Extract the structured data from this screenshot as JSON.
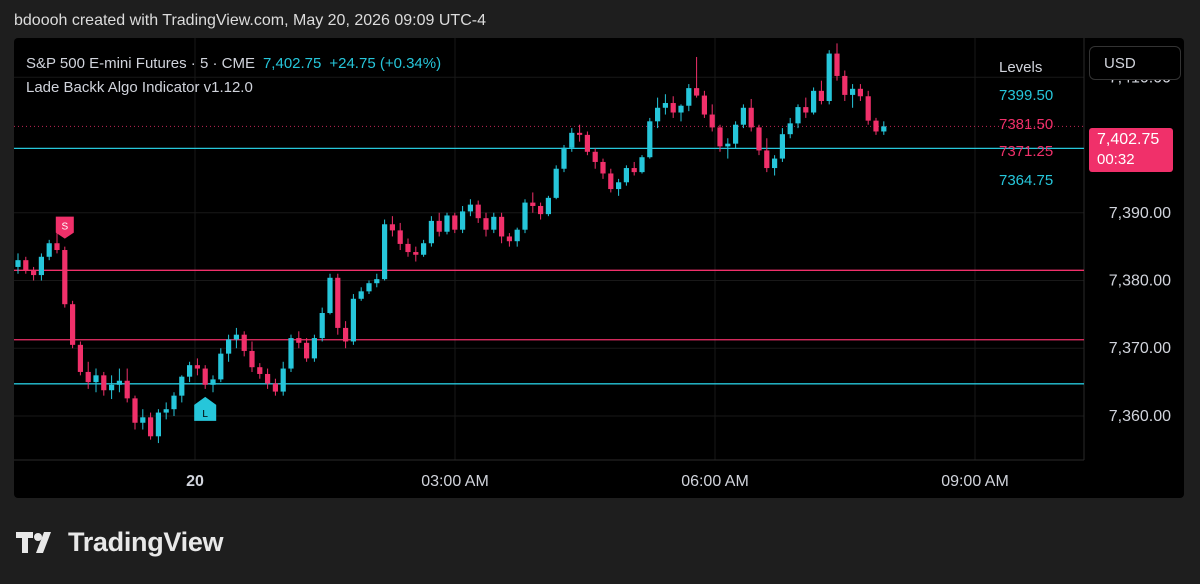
{
  "header": {
    "credit": "bdoooh created with TradingView.com, May 20, 2026 09:09 UTC-4"
  },
  "legend": {
    "symbol": "S&P 500 E-mini Futures · 5 · CME",
    "last": "7,402.75",
    "change": "+24.75 (+0.34%)",
    "indicator": "Lade Backk Algo Indicator v1.12.0"
  },
  "currency": "USD",
  "price_tag": {
    "value": "7,402.75",
    "countdown": "00:32"
  },
  "levels_title": "Levels",
  "brand": {
    "name": "TradingView"
  },
  "colors": {
    "up": "#26c6da",
    "down": "#f0306a",
    "background": "#000000"
  },
  "chart_data": {
    "type": "candlestick",
    "x_ticks": [
      "20",
      "03:00 AM",
      "06:00 AM",
      "09:00 AM"
    ],
    "y_ticks": [
      "7,410.00",
      "7,390.00",
      "7,380.00",
      "7,370.00",
      "7,360.00"
    ],
    "ylim": [
      7353.5,
      7415.8
    ],
    "levels": [
      {
        "label": "7399.50",
        "value": 7399.5,
        "color": "#26c6da"
      },
      {
        "label": "7381.50",
        "value": 7381.5,
        "color": "#f0306a"
      },
      {
        "label": "7371.25",
        "value": 7371.25,
        "color": "#f0306a"
      },
      {
        "label": "7364.75",
        "value": 7364.75,
        "color": "#26c6da"
      }
    ],
    "last_price": 7402.75,
    "signals": [
      {
        "label": "S",
        "type": "sell",
        "index": 6
      },
      {
        "label": "L",
        "type": "long",
        "index": 24
      }
    ],
    "ohlc": [
      [
        7382,
        7384,
        7381,
        7383
      ],
      [
        7383,
        7383.5,
        7381,
        7381.5
      ],
      [
        7381.5,
        7382,
        7380,
        7380.8
      ],
      [
        7380.8,
        7384,
        7380,
        7383.5
      ],
      [
        7383.5,
        7386,
        7383,
        7385.5
      ],
      [
        7385.5,
        7387.5,
        7384,
        7384.5
      ],
      [
        7384.5,
        7385,
        7376,
        7376.5
      ],
      [
        7376.5,
        7377,
        7370,
        7370.5
      ],
      [
        7370.5,
        7371,
        7366,
        7366.5
      ],
      [
        7366.5,
        7368,
        7364,
        7365
      ],
      [
        7365,
        7367,
        7363.5,
        7366
      ],
      [
        7366,
        7366.5,
        7363,
        7363.8
      ],
      [
        7363.8,
        7366,
        7362.5,
        7364.6
      ],
      [
        7364.6,
        7367,
        7363.5,
        7365.2
      ],
      [
        7365.2,
        7367,
        7362,
        7362.6
      ],
      [
        7362.6,
        7363,
        7358,
        7359
      ],
      [
        7359,
        7361,
        7358,
        7359.8
      ],
      [
        7359.8,
        7360.5,
        7356.5,
        7357
      ],
      [
        7357,
        7361,
        7356,
        7360.5
      ],
      [
        7360.5,
        7362,
        7359.5,
        7361
      ],
      [
        7361,
        7363.5,
        7360,
        7363
      ],
      [
        7363,
        7366,
        7362,
        7365.8
      ],
      [
        7365.8,
        7368,
        7365,
        7367.5
      ],
      [
        7367.5,
        7368.5,
        7366,
        7367
      ],
      [
        7367,
        7367.5,
        7364,
        7364.6
      ],
      [
        7364.6,
        7366,
        7363.5,
        7365.4
      ],
      [
        7365.4,
        7370,
        7365,
        7369.2
      ],
      [
        7369.2,
        7372,
        7368,
        7371.3
      ],
      [
        7371.3,
        7373,
        7370,
        7372
      ],
      [
        7372,
        7372.5,
        7368.8,
        7369.6
      ],
      [
        7369.6,
        7371,
        7366.5,
        7367.2
      ],
      [
        7367.2,
        7367.8,
        7365.5,
        7366.2
      ],
      [
        7366.2,
        7367,
        7364,
        7364.8
      ],
      [
        7364.8,
        7365.5,
        7363,
        7363.6
      ],
      [
        7363.6,
        7368,
        7363,
        7367
      ],
      [
        7367,
        7372,
        7366.5,
        7371.5
      ],
      [
        7371.5,
        7372.5,
        7370,
        7370.8
      ],
      [
        7370.8,
        7371.5,
        7368,
        7368.5
      ],
      [
        7368.5,
        7372,
        7368,
        7371.5
      ],
      [
        7371.5,
        7376,
        7371,
        7375.2
      ],
      [
        7375.2,
        7381,
        7375,
        7380.4
      ],
      [
        7380.4,
        7381,
        7372,
        7373
      ],
      [
        7373,
        7374,
        7370,
        7371
      ],
      [
        7371,
        7378,
        7370.5,
        7377.3
      ],
      [
        7377.3,
        7379,
        7377,
        7378.4
      ],
      [
        7378.4,
        7380,
        7378,
        7379.6
      ],
      [
        7379.6,
        7381,
        7379,
        7380.2
      ],
      [
        7380.2,
        7389,
        7380,
        7388.3
      ],
      [
        7388.3,
        7389.5,
        7386.5,
        7387.4
      ],
      [
        7387.4,
        7388.5,
        7384.5,
        7385.4
      ],
      [
        7385.4,
        7386.2,
        7383.5,
        7384.2
      ],
      [
        7384.2,
        7385,
        7382.8,
        7383.8
      ],
      [
        7383.8,
        7386,
        7383.5,
        7385.5
      ],
      [
        7385.5,
        7389.5,
        7385,
        7388.8
      ],
      [
        7388.8,
        7390,
        7386.5,
        7387.2
      ],
      [
        7387.2,
        7390,
        7386.8,
        7389.6
      ],
      [
        7389.6,
        7390,
        7387,
        7387.5
      ],
      [
        7387.5,
        7391,
        7387,
        7390.2
      ],
      [
        7390.2,
        7392,
        7389.5,
        7391.2
      ],
      [
        7391.2,
        7391.8,
        7388.5,
        7389.2
      ],
      [
        7389.2,
        7390,
        7386.5,
        7387.5
      ],
      [
        7387.5,
        7390,
        7387,
        7389.4
      ],
      [
        7389.4,
        7390,
        7385.5,
        7386.5
      ],
      [
        7386.5,
        7387,
        7385,
        7385.8
      ],
      [
        7385.8,
        7387.8,
        7385,
        7387.5
      ],
      [
        7387.5,
        7392,
        7387,
        7391.5
      ],
      [
        7391.5,
        7393,
        7390,
        7391
      ],
      [
        7391,
        7391.5,
        7389,
        7389.8
      ],
      [
        7389.8,
        7392.5,
        7389.5,
        7392.2
      ],
      [
        7392.2,
        7397,
        7392,
        7396.5
      ],
      [
        7396.5,
        7400,
        7396,
        7399.6
      ],
      [
        7399.6,
        7402.5,
        7399,
        7401.8
      ],
      [
        7401.8,
        7403,
        7400.5,
        7401.5
      ],
      [
        7401.5,
        7402,
        7398.5,
        7399
      ],
      [
        7399,
        7399.5,
        7396.5,
        7397.5
      ],
      [
        7397.5,
        7398,
        7395,
        7395.8
      ],
      [
        7395.8,
        7396.5,
        7393,
        7393.5
      ],
      [
        7393.5,
        7395,
        7392.5,
        7394.5
      ],
      [
        7394.5,
        7397,
        7394,
        7396.6
      ],
      [
        7396.6,
        7397.5,
        7395.5,
        7396
      ],
      [
        7396,
        7398.5,
        7395.8,
        7398.2
      ],
      [
        7398.2,
        7404,
        7398,
        7403.5
      ],
      [
        7403.5,
        7407,
        7402.5,
        7405.5
      ],
      [
        7405.5,
        7407.5,
        7404.5,
        7406.2
      ],
      [
        7406.2,
        7407.2,
        7404,
        7404.8
      ],
      [
        7404.8,
        7406,
        7403.5,
        7405.8
      ],
      [
        7405.8,
        7409,
        7405,
        7408.4
      ],
      [
        7408.4,
        7413,
        7407,
        7407.3
      ],
      [
        7407.3,
        7408,
        7404,
        7404.5
      ],
      [
        7404.5,
        7406,
        7402,
        7402.6
      ],
      [
        7402.6,
        7403,
        7399,
        7399.8
      ],
      [
        7399.8,
        7401,
        7398,
        7400.2
      ],
      [
        7400.2,
        7403.5,
        7399.5,
        7403
      ],
      [
        7403,
        7406,
        7402.5,
        7405.5
      ],
      [
        7405.5,
        7406.8,
        7402,
        7402.6
      ],
      [
        7402.6,
        7403,
        7398.5,
        7399.2
      ],
      [
        7399.2,
        7401,
        7396,
        7396.6
      ],
      [
        7396.6,
        7398.5,
        7395.5,
        7398
      ],
      [
        7398,
        7402.5,
        7397.5,
        7401.6
      ],
      [
        7401.6,
        7404,
        7401,
        7403.2
      ],
      [
        7403.2,
        7406,
        7402.5,
        7405.6
      ],
      [
        7405.6,
        7407,
        7404,
        7404.8
      ],
      [
        7404.8,
        7408.5,
        7404.5,
        7408
      ],
      [
        7408,
        7409.5,
        7406,
        7406.5
      ],
      [
        7406.5,
        7414,
        7406,
        7413.5
      ],
      [
        7413.5,
        7415,
        7409.5,
        7410.2
      ],
      [
        7410.2,
        7411,
        7406.5,
        7407.4
      ],
      [
        7407.4,
        7409,
        7405.5,
        7408.3
      ],
      [
        7408.3,
        7409,
        7406.5,
        7407.2
      ],
      [
        7407.2,
        7408,
        7403,
        7403.6
      ],
      [
        7403.6,
        7404,
        7401.5,
        7402
      ],
      [
        7402,
        7403.5,
        7401.5,
        7402.75
      ]
    ]
  }
}
